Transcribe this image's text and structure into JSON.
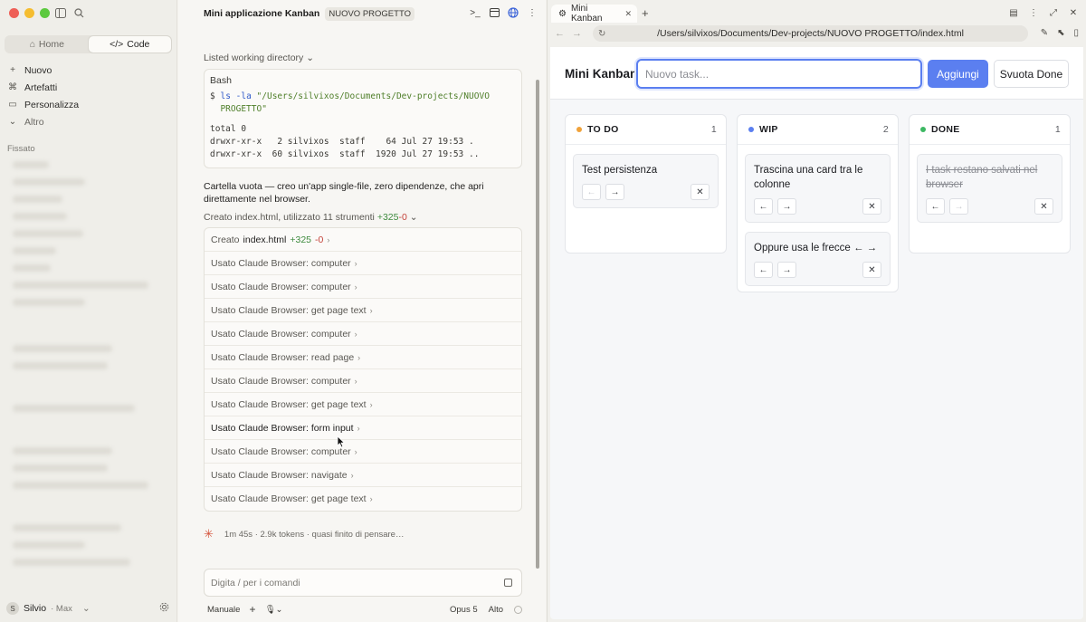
{
  "sidebar": {
    "segment": {
      "home": "Home",
      "code": "Code"
    },
    "menu": [
      {
        "icon": "+",
        "label": "Nuovo"
      },
      {
        "icon": "⌘",
        "label": "Artefatti"
      },
      {
        "icon": "▭",
        "label": "Personalizza"
      },
      {
        "icon": "⌄",
        "label": "Altro"
      }
    ],
    "pinned_header": "Fissato",
    "user": {
      "initial": "S",
      "name": "Silvio",
      "plan": "Max"
    }
  },
  "chat": {
    "title": "Mini applicazione Kanban",
    "project_badge": "NUOVO PROGETTO",
    "listed_label": "Listed working directory",
    "bash": {
      "title": "Bash",
      "prompt": "$",
      "command": "ls -la",
      "path_line1": "\"/Users/silvixos/Documents/Dev-projects/NUOVO",
      "path_line2": "PROGETTO\"",
      "output": "total 0\ndrwxr-xr-x   2 silvixos  staff    64 Jul 27 19:53 .\ndrwxr-xr-x  60 silvixos  staff  1920 Jul 27 19:53 .."
    },
    "assistant_text": "Cartella vuota — creo un'app single-file, zero dipendenze, che apri direttamente nel browser.",
    "created_summary": {
      "text": "Creato index.html, utilizzato 11 strumenti",
      "added": "+325",
      "removed": "-0"
    },
    "created_row": {
      "prefix": "Creato",
      "file": "index.html",
      "added": "+325",
      "removed": "-0"
    },
    "tool_calls": [
      "Usato Claude Browser: computer",
      "Usato Claude Browser: computer",
      "Usato Claude Browser: get page text",
      "Usato Claude Browser: computer",
      "Usato Claude Browser: read page",
      "Usato Claude Browser: computer",
      "Usato Claude Browser: get page text",
      "Usato Claude Browser: form input",
      "Usato Claude Browser: computer",
      "Usato Claude Browser: navigate",
      "Usato Claude Browser: get page text"
    ],
    "status": {
      "time": "1m 45s",
      "tokens": "· 2.9k tokens",
      "thinking": "· quasi finito di pensare…"
    },
    "input_placeholder": "Digita / per i comandi",
    "bottom": {
      "mode": "Manuale",
      "model": "Opus 5",
      "effort": "Alto"
    }
  },
  "browser": {
    "tab_title": "Mini Kanban",
    "url": "/Users/silvixos/Documents/Dev-projects/NUOVO PROGETTO/index.html",
    "app": {
      "title": "Mini Kanban",
      "input_placeholder": "Nuovo task...",
      "add_button": "Aggiungi",
      "clear_button": "Svuota Done",
      "columns": [
        {
          "name": "TO DO",
          "count": "1",
          "color": "#f0a23a",
          "cards": [
            {
              "text": "Test persistenza",
              "left_disabled": true,
              "right_disabled": false
            }
          ]
        },
        {
          "name": "WIP",
          "count": "2",
          "color": "#5b7ff0",
          "cards": [
            {
              "text": "Trascina una card tra le colonne",
              "left_disabled": false,
              "right_disabled": false
            },
            {
              "text": "Oppure usa le frecce ← →",
              "left_disabled": false,
              "right_disabled": false
            }
          ]
        },
        {
          "name": "DONE",
          "count": "1",
          "color": "#3db863",
          "cards": [
            {
              "text": "I task restano salvati nel browser",
              "done": true,
              "left_disabled": false,
              "right_disabled": true
            }
          ]
        }
      ]
    }
  }
}
